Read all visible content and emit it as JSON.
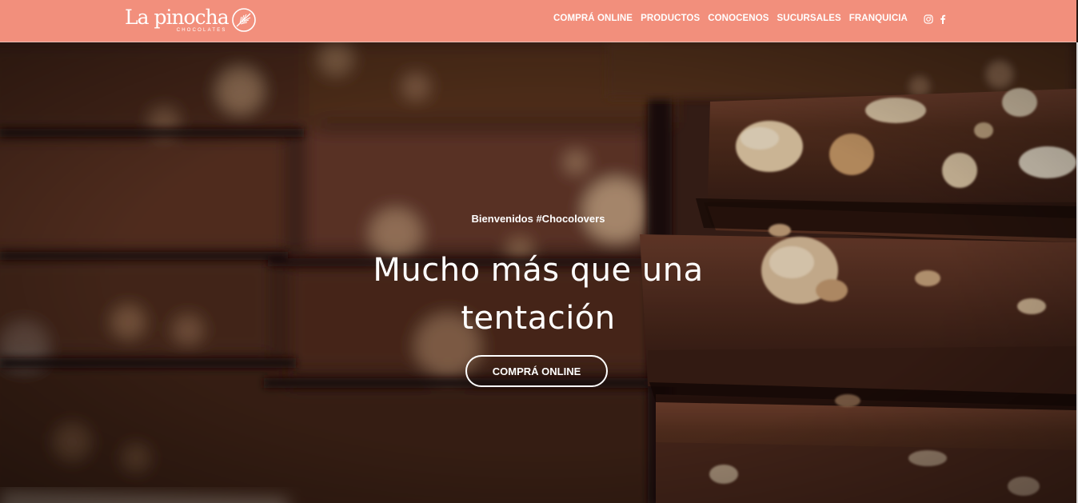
{
  "header": {
    "logo": {
      "name": "La pinocha",
      "tagline": "CHOCOLATES"
    },
    "nav": [
      {
        "label": "COMPRÁ ONLINE"
      },
      {
        "label": "PRODUCTOS"
      },
      {
        "label": "CONOCENOS"
      },
      {
        "label": "SUCURSALES"
      },
      {
        "label": "FRANQUICIA"
      }
    ],
    "social": [
      {
        "icon": "instagram-icon"
      },
      {
        "icon": "facebook-icon"
      }
    ]
  },
  "hero": {
    "eyebrow": "Bienvenidos #Chocolovers",
    "headline_line1": "Mucho más que una",
    "headline_line2": "tentación",
    "cta_label": "COMPRÁ ONLINE",
    "background": "chocolate-bars-photo"
  },
  "colors": {
    "header_bg": "#f28f7c",
    "text": "#ffffff",
    "chocolate_dark": "#3a1f16",
    "chocolate_mid": "#5b3325",
    "nut": "#d9b58c"
  }
}
